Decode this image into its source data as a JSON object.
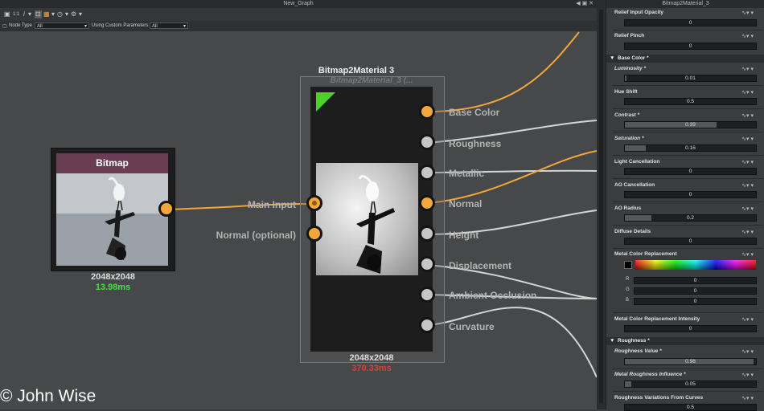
{
  "graph": {
    "title": "New_Graph",
    "toolbar": {
      "zoom_label": "1:1",
      "info_label": "i"
    },
    "filter": {
      "node_type_label": "Node Type",
      "node_type_value": "All",
      "custom_params_label": "Using Custom Parameters",
      "custom_params_value": "All"
    }
  },
  "nodes": {
    "bitmap": {
      "title": "Bitmap",
      "resolution": "2048x2048",
      "time": "13.98ms",
      "output_port_color": "#f2a73a"
    },
    "b2m": {
      "title": "Bitmap2Material 3",
      "subtitle": "Bitmap2Material_3 (...",
      "resolution": "2048x2048",
      "time": "370.33ms",
      "inputs": [
        {
          "label": "Main Input",
          "state": "connected"
        },
        {
          "label": "Normal (optional)",
          "state": "available"
        }
      ],
      "outputs": [
        {
          "label": "Base Color",
          "connected": true
        },
        {
          "label": "Roughness",
          "connected": true
        },
        {
          "label": "Metallic",
          "connected": true
        },
        {
          "label": "Normal",
          "connected": true
        },
        {
          "label": "Height",
          "connected": true
        },
        {
          "label": "Displacement",
          "connected": true
        },
        {
          "label": "Ambient Occlusion",
          "connected": true
        },
        {
          "label": "Curvature",
          "connected": true
        }
      ]
    }
  },
  "watermark": "© John Wise",
  "panel": {
    "title": "Bitmap2Material_3",
    "icon_glyph": "∿▾ ▾",
    "rgb": [
      "R",
      "G",
      "B"
    ],
    "props": {
      "relief_input_opacity": {
        "label": "Relief Input Opacity",
        "value": "0",
        "fill": 0
      },
      "relief_pinch": {
        "label": "Relief Pinch",
        "value": "0",
        "fill": 0
      },
      "base_color_section": "Base Color *",
      "luminosity": {
        "label": "Luminosity *",
        "value": "0.01",
        "fill": 0.01
      },
      "hue_shift": {
        "label": "Hue Shift",
        "value": "0.5",
        "fill": 0
      },
      "contrast": {
        "label": "Contrast *",
        "value": "0.39",
        "fill": 0.7
      },
      "saturation": {
        "label": "Saturation *",
        "value": "0.16",
        "fill": 0.16
      },
      "light_cancellation": {
        "label": "Light Cancellation",
        "value": "0",
        "fill": 0
      },
      "ao_cancellation": {
        "label": "AO Cancellation",
        "value": "0",
        "fill": 0
      },
      "ao_radius": {
        "label": "AO Radius",
        "value": "0.2",
        "fill": 0.2
      },
      "diffuse_details": {
        "label": "Diffuse Details",
        "value": "0",
        "fill": 0
      },
      "metal_color_replacement": {
        "label": "Metal Color Replacement",
        "r": "0",
        "g": "0",
        "b": "0"
      },
      "metal_color_intensity": {
        "label": "Metal Color Replacement Intensity",
        "value": "0",
        "fill": 0
      },
      "roughness_section": "Roughness *",
      "roughness_value": {
        "label": "Roughness Value *",
        "value": "0.98",
        "fill": 0.98
      },
      "metal_roughness_influence": {
        "label": "Metal Roughness Influence *",
        "value": "0.05",
        "fill": 0.05
      },
      "roughness_variations": {
        "label": "Roughness Variations From Curves",
        "value": "0.5"
      }
    }
  }
}
